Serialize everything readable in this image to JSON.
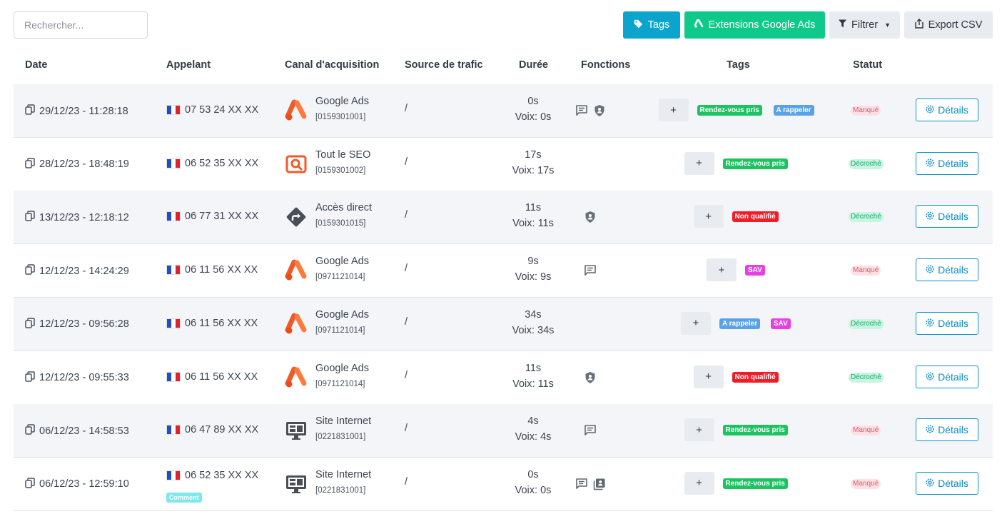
{
  "toolbar": {
    "search_placeholder": "Rechercher...",
    "tags_label": "Tags",
    "extensions_label": "Extensions Google Ads",
    "filter_label": "Filtrer",
    "export_label": "Export CSV"
  },
  "columns": {
    "date": "Date",
    "caller": "Appelant",
    "channel": "Canal d'acquisition",
    "source": "Source de trafic",
    "duration": "Durée",
    "functions": "Fonctions",
    "tags": "Tags",
    "status": "Statut"
  },
  "colors": {
    "tags_button": "#0ba4cc",
    "extensions_button": "#0ec98a",
    "tag_rdv": "#1cc461",
    "tag_rappeler": "#5aa2e8",
    "tag_non_qualifie": "#ef1d28",
    "tag_sav": "#e83ee8",
    "status_missed": "#e55869",
    "status_answered": "#12a66a"
  },
  "common": {
    "plus_label": "+",
    "details_label": "Détails"
  },
  "rows": [
    {
      "date": "29/12/23 - 11:28:18",
      "caller": "07 53 24 XX XX",
      "channel_icon": "google-ads-icon",
      "channel": "Google Ads",
      "channel_number": "[0159301001]",
      "source": "/",
      "duration": "0s",
      "voice": "Voix: 0s",
      "functions": [
        "message-icon",
        "shield-icon"
      ],
      "tags": [
        "Rendez-vous pris",
        "A rappeler"
      ],
      "status": "Manqué",
      "details": "Détails"
    },
    {
      "date": "28/12/23 - 18:48:19",
      "caller": "06 52 35 XX XX",
      "channel_icon": "seo-icon",
      "channel": "Tout le SEO",
      "channel_number": "[0159301002]",
      "source": "/",
      "duration": "17s",
      "voice": "Voix: 17s",
      "functions": [],
      "tags": [
        "Rendez-vous pris"
      ],
      "status": "Décroché",
      "details": "Détails"
    },
    {
      "date": "13/12/23 - 12:18:12",
      "caller": "06 77 31 XX XX",
      "channel_icon": "direct-access-icon",
      "channel": "Accès direct",
      "channel_number": "[0159301015]",
      "source": "/",
      "duration": "11s",
      "voice": "Voix: 11s",
      "functions": [
        "shield-icon"
      ],
      "tags": [
        "Non qualifié"
      ],
      "status": "Décroché",
      "details": "Détails"
    },
    {
      "date": "12/12/23 - 14:24:29",
      "caller": "06 11 56 XX XX",
      "channel_icon": "google-ads-icon",
      "channel": "Google Ads",
      "channel_number": "[0971121014]",
      "source": "/",
      "duration": "9s",
      "voice": "Voix: 9s",
      "functions": [
        "message-icon"
      ],
      "tags": [
        "SAV"
      ],
      "status": "Manqué",
      "details": "Détails"
    },
    {
      "date": "12/12/23 - 09:56:28",
      "caller": "06 11 56 XX XX",
      "channel_icon": "google-ads-icon",
      "channel": "Google Ads",
      "channel_number": "[0971121014]",
      "source": "/",
      "duration": "34s",
      "voice": "Voix: 34s",
      "functions": [],
      "tags": [
        "A rappeler",
        "SAV"
      ],
      "status": "Décroché",
      "details": "Détails"
    },
    {
      "date": "12/12/23 - 09:55:33",
      "caller": "06 11 56 XX XX",
      "channel_icon": "google-ads-icon",
      "channel": "Google Ads",
      "channel_number": "[0971121014]",
      "source": "/",
      "duration": "11s",
      "voice": "Voix: 11s",
      "functions": [
        "shield-icon"
      ],
      "tags": [
        "Non qualifié"
      ],
      "status": "Décroché",
      "details": "Détails"
    },
    {
      "date": "06/12/23 - 14:58:53",
      "caller": "06 47 89 XX XX",
      "channel_icon": "website-icon",
      "channel": "Site Internet",
      "channel_number": "[0221831001]",
      "source": "/",
      "duration": "4s",
      "voice": "Voix: 4s",
      "functions": [
        "message-icon"
      ],
      "tags": [
        "Rendez-vous pris"
      ],
      "status": "Manqué",
      "details": "Détails"
    },
    {
      "date": "06/12/23 - 12:59:10",
      "caller": "06 52 35 XX XX",
      "caller_badge": "Comment",
      "channel_icon": "website-icon",
      "channel": "Site Internet",
      "channel_number": "[0221831001]",
      "source": "/",
      "duration": "0s",
      "voice": "Voix: 0s",
      "functions": [
        "message-icon",
        "contact-card-icon"
      ],
      "tags": [
        "Rendez-vous pris"
      ],
      "status": "Manqué",
      "details": "Détails"
    }
  ]
}
